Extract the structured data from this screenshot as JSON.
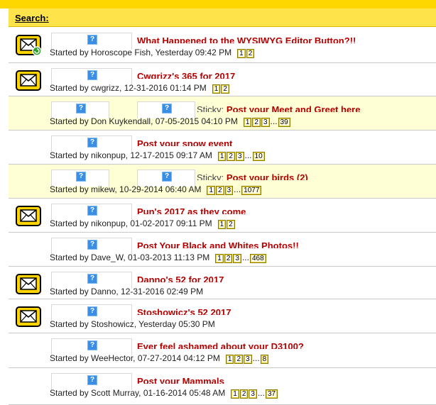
{
  "header": {
    "label": "Search:"
  },
  "colors": {
    "bar": "#ffd700",
    "header": "#ffe34a",
    "title": "#b30000",
    "sticky_bg": "#ffffd6"
  },
  "threads": [
    {
      "title": "What Happened to the WYSIWYG Editor Button?!!",
      "starter": "Started by Horoscope Fish, Yesterday 09:42 PM",
      "pages": [
        "1",
        "2"
      ],
      "last_page": "",
      "icon": "envelope-new-icon"
    },
    {
      "title": "Cwgrizz's 365 for 2017",
      "starter": "Started by cwgrizz, 12-31-2016 01:14 PM",
      "pages": [
        "1",
        "2"
      ],
      "last_page": "",
      "icon": "envelope-icon"
    },
    {
      "sticky_label": "Sticky:",
      "title": "Post your Meet and Greet here",
      "starter": "Started by Don Kuykendall, 07-05-2015 04:10 PM",
      "pages": [
        "1",
        "2",
        "3"
      ],
      "last_page": "39",
      "icon": ""
    },
    {
      "title": "Post your snow event",
      "starter": "Started by nikonpup, 12-17-2015 09:17 AM",
      "pages": [
        "1",
        "2",
        "3"
      ],
      "last_page": "10",
      "icon": ""
    },
    {
      "sticky_label": "Sticky:",
      "title": "Post your birds (2)",
      "starter": "Started by mikew, 10-29-2014 06:40 AM",
      "pages": [
        "1",
        "2",
        "3"
      ],
      "last_page": "1077",
      "icon": ""
    },
    {
      "title": "Pun's 2017 as they come",
      "starter": "Started by nikonpup, 01-02-2017 09:11 PM",
      "pages": [
        "1",
        "2"
      ],
      "last_page": "",
      "icon": "envelope-icon"
    },
    {
      "title": "Post Your Black and Whites Photos!!",
      "starter": "Started by Dave_W, 01-03-2013 11:13 PM",
      "pages": [
        "1",
        "2",
        "3"
      ],
      "last_page": "468",
      "icon": ""
    },
    {
      "title": "Danno's 52 for 2017",
      "starter": "Started by Danno, 12-31-2016 02:49 PM",
      "pages": [],
      "last_page": "",
      "icon": "envelope-icon"
    },
    {
      "title": "Stoshowicz's 52 2017",
      "starter": "Started by Stoshowicz, Yesterday 05:30 PM",
      "pages": [],
      "last_page": "",
      "icon": "envelope-icon"
    },
    {
      "title": "Ever feel ashamed about your D3100?",
      "starter": "Started by WeeHector, 07-27-2014 04:12 PM",
      "pages": [
        "1",
        "2",
        "3"
      ],
      "last_page": "8",
      "icon": ""
    },
    {
      "title": "Post your Mammals",
      "starter": "Started by Scott Murray, 01-16-2014 05:48 AM",
      "pages": [
        "1",
        "2",
        "3"
      ],
      "last_page": "37",
      "icon": ""
    }
  ]
}
